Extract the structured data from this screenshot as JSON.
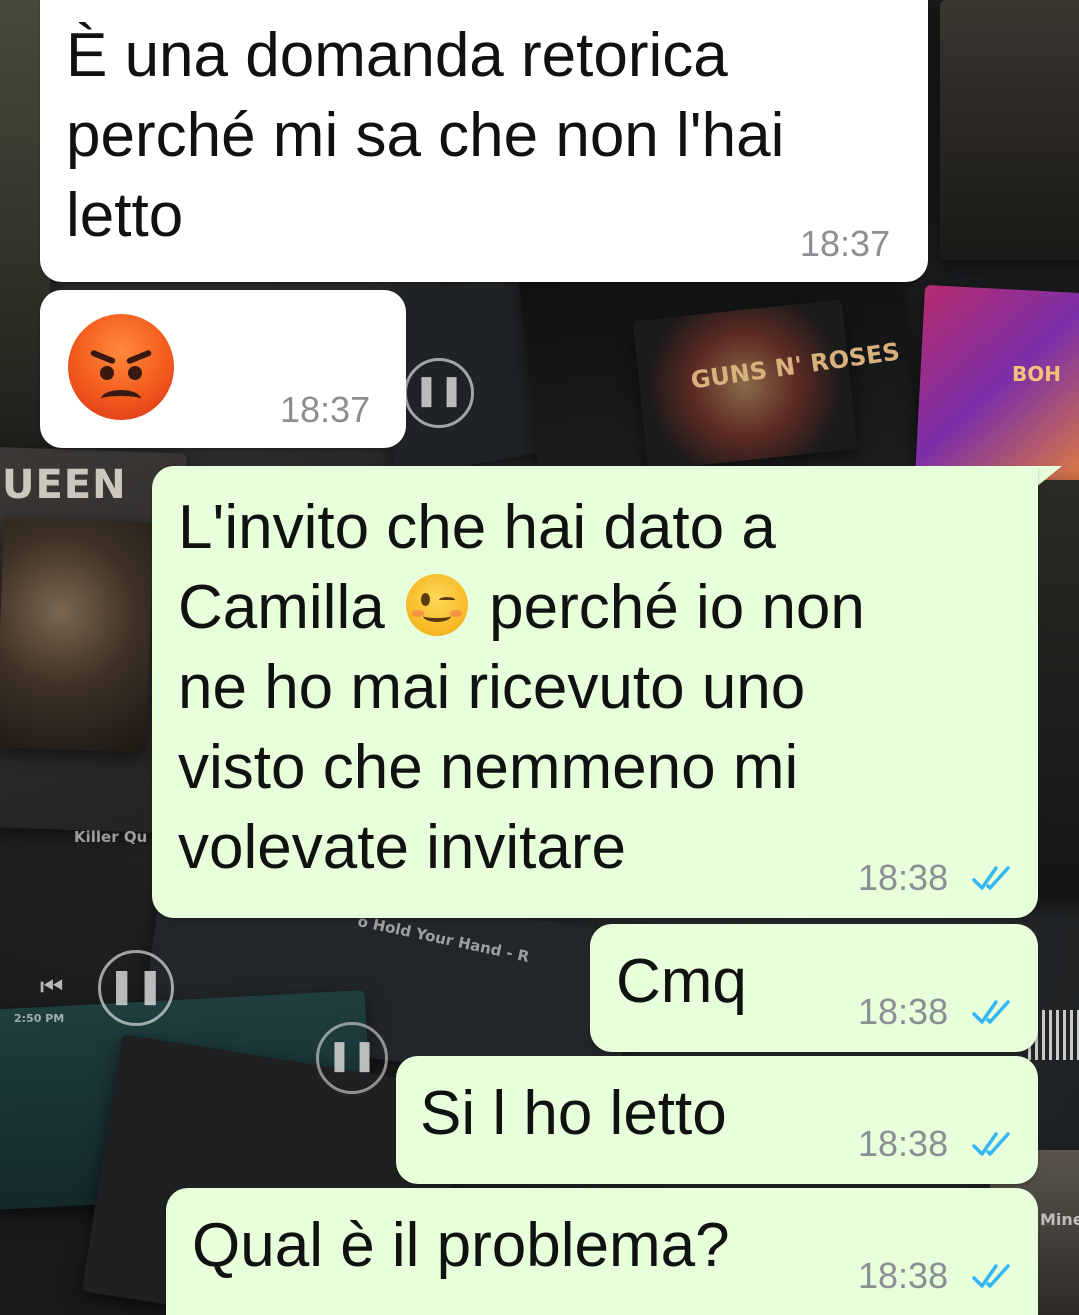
{
  "wallpaper": {
    "album_texts": {
      "queen": "UEEN",
      "killer_queen": "Killer Qu",
      "hold_your_hand": "o Hold Your Hand - R",
      "bohemian": "BOH",
      "guns_n_roses": "GUNS N' ROSES",
      "mine": "Mine",
      "status_time": "2:50 PM"
    }
  },
  "messages": [
    {
      "direction": "incoming",
      "text": "È una domanda retorica\nperché mi sa che non l'hai\nletto",
      "time": "18:37"
    },
    {
      "direction": "incoming",
      "emoji": "angry-face",
      "time": "18:37"
    },
    {
      "direction": "outgoing",
      "text_before": "L'invito che hai dato a\nCamilla ",
      "emoji": "winking-face",
      "text_after": " perché io non\nne ho mai ricevuto uno\nvisto che nemmeno mi\nvolevate invitare",
      "time": "18:38",
      "status": "read"
    },
    {
      "direction": "outgoing",
      "text": "Cmq",
      "time": "18:38",
      "status": "read"
    },
    {
      "direction": "outgoing",
      "text": "Si l ho letto",
      "time": "18:38",
      "status": "read"
    },
    {
      "direction": "outgoing",
      "text": "Qual è il problema?",
      "time": "18:38",
      "status": "read"
    }
  ],
  "colors": {
    "incoming_bubble": "#ffffff",
    "outgoing_bubble": "#e7ffdb",
    "read_ticks": "#34b7f1",
    "timestamp": "#8a8f92"
  }
}
